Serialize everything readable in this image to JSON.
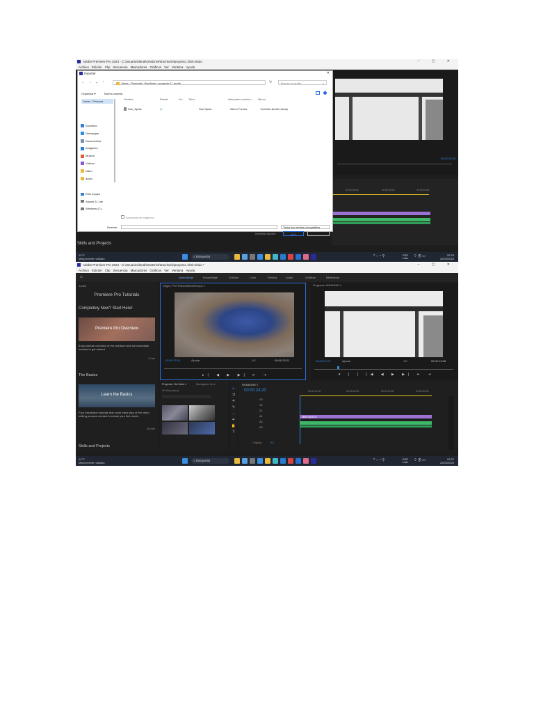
{
  "shot1": {
    "title": "Adobe Premiere Pro 2024 - C:\\Usuarios\\lenal\\OneDrive\\Escritorio\\proyecto 2\\Sin título",
    "menu": [
      "Archivo",
      "Edición",
      "Clip",
      "Secuencia",
      "Marcadores",
      "Gráficos",
      "Ver",
      "Ventana",
      "Ayuda"
    ],
    "window_controls": "–  ▢  ✕",
    "dialog": {
      "title": "Importar",
      "close": "✕",
      "path": "Josue - Personal  ›  Escritorio  ›  proyecto 2  ›  audio",
      "search_placeholder": "Buscar en audio",
      "organize": "Organizar ▾",
      "new_folder": "Nueva carpeta",
      "sidebar_top": "Josue - Persona",
      "sidebar": [
        "Escritorio",
        "Descargas",
        "Documentos",
        "Imágenes",
        "Música",
        "Vídeos",
        "video",
        "audio"
      ],
      "sidebar_bottom": [
        "Este equipo",
        "Xiaomi 11 Lite",
        "Windows (C:)"
      ],
      "columns": [
        "Nombre",
        "Estado",
        "Nú...",
        "Título",
        "Intérpretes contribu...",
        "Álbum"
      ],
      "file": {
        "name": "Sun_Spots",
        "title": "Sun Spots",
        "artist": "Glenn Frenes",
        "album": "YouTube Audio Library"
      },
      "image_sequence_label": "Secuencia de imágenes",
      "filename_label": "Nombre:",
      "filetype": "Todos los medios compatibles",
      "import_folder": "Importar carpeta",
      "open": "Abrir",
      "cancel": "Cancelar"
    },
    "right_panel_timecode": "00:02:13:28",
    "ruler": [
      "00:00:08:00",
      "00:00:16:00",
      "00:00:24:00"
    ],
    "left_bottom": "Skills and Projects",
    "taskbar": {
      "weather_temp": "14°C",
      "weather_text": "Mayormente nublado",
      "search": "Búsqueda",
      "lang": "ESP",
      "lang2": "LAA",
      "time": "22:23",
      "date": "22/02/2024"
    }
  },
  "shot2": {
    "title": "Adobe Premiere Pro 2024 - C:\\Usuarios\\lenal\\OneDrive\\Escritorio\\proyecto 2\\Sin título *",
    "menu": [
      "Archivo",
      "Edición",
      "Clip",
      "Secuencia",
      "Marcadores",
      "Gráficos",
      "Ver",
      "Ventana",
      "Ayuda"
    ],
    "window_controls": "–  ▢  ✕",
    "workspaces": [
      "Aprendizaje",
      "Ensamblaje",
      "Edición",
      "Color",
      "Efectos",
      "Audio",
      "Gráficos",
      "Bibliotecas"
    ],
    "learn": {
      "panel_label": "Learn",
      "heading": "Premiere Pro Tutorials",
      "subheading": "Completely New? Start Here!",
      "card1_title": "Premiere Pro Overview",
      "card1_desc": "A two-minute overview of the interface and the essentials needed to get started.",
      "card1_time": "2 min",
      "section2": "The Basics",
      "card2_title": "Learn the Basics",
      "card2_desc": "Four interactive tutorials that cover each step of the video editing process needed to create your first movie.",
      "card2_time": "15 min",
      "section3": "Skills and Projects"
    },
    "source": {
      "label": "Origen: PUTTINGONSHOES.mp4 ≡",
      "tc_left": "00:00:13:20",
      "fit": "Ajustar",
      "fraction": "1/2",
      "tc_right": "00:00:13:21"
    },
    "program": {
      "label": "Programa: HUNAGHE ≡",
      "tc_left": "00:00:24:20",
      "fit": "Ajustar",
      "fraction": "1/2",
      "tc_right": "00:02:13:28"
    },
    "project": {
      "tabs": [
        "Proyecto: Sin título ≡",
        "Navegador de m"
      ],
      "item": "Sin título.prproj",
      "count": "1 de 4 elementos"
    },
    "timeline": {
      "label": "HUNAGHE ≡",
      "timecode": "00:00:24:20",
      "ruler": [
        "00:00:12:00",
        "00:00:18:00",
        "00:00:24:00",
        "00:00:30:00"
      ],
      "clip": "video.mp4 [V]",
      "tracks": [
        "V3",
        "V2",
        "V1",
        "A1",
        "A2",
        "A3"
      ],
      "mix": "Original",
      "mix_val": "0.0"
    },
    "taskbar": {
      "weather_temp": "14°C",
      "weather_text": "Mayormente nublado",
      "search": "Búsqueda",
      "lang": "ESP",
      "lang2": "LAA",
      "time": "22:37",
      "date": "22/02/2024"
    }
  },
  "colors": {
    "accent": "#2d8ceb",
    "clip": "#9b72d4",
    "audio": "#3fb86a",
    "timeline_line": "#e8c31e"
  }
}
